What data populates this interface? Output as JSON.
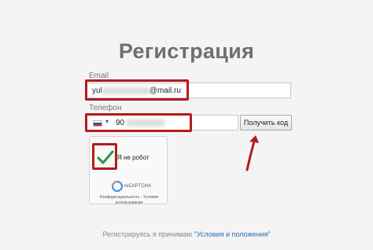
{
  "form": {
    "title": "Регистрация",
    "email_label": "Email",
    "email_prefix": "yul",
    "email_suffix": "@mail.ru",
    "phone_label": "Телефон",
    "phone_prefix": "90",
    "get_code_button": "Получить код",
    "highlight_color": "#b31b1b"
  },
  "captcha": {
    "label": "Я не робот",
    "brand": "reCAPTCHA",
    "links": "Конфиденциальность - Условия использования"
  },
  "footer": {
    "text": "Регистрируясь я принимаю ",
    "link": "\"Условия и положения\""
  }
}
